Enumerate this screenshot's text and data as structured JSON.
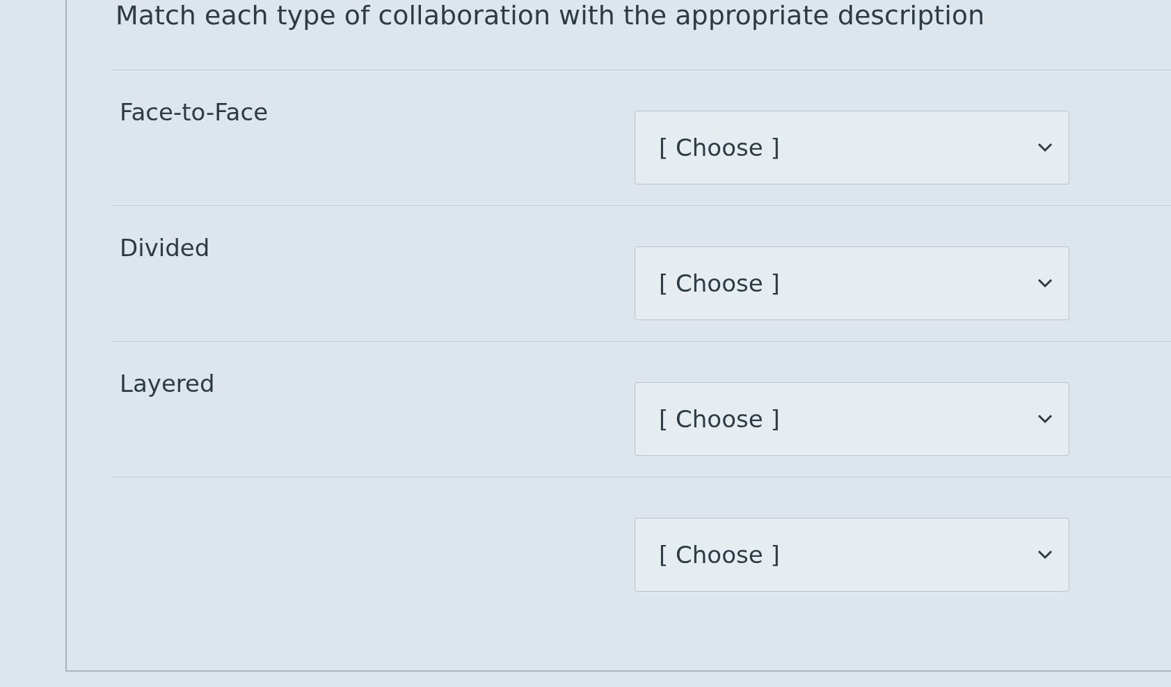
{
  "question": {
    "text": "Match each type of collaboration with the appropriate description"
  },
  "rows": [
    {
      "label": "Face-to-Face",
      "select": {
        "value": "[ Choose ]"
      }
    },
    {
      "label": "Divided",
      "select": {
        "value": "[ Choose ]"
      }
    },
    {
      "label": "Layered",
      "select": {
        "value": "[ Choose ]"
      }
    },
    {
      "select": {
        "value": "[ Choose ]"
      }
    }
  ]
}
